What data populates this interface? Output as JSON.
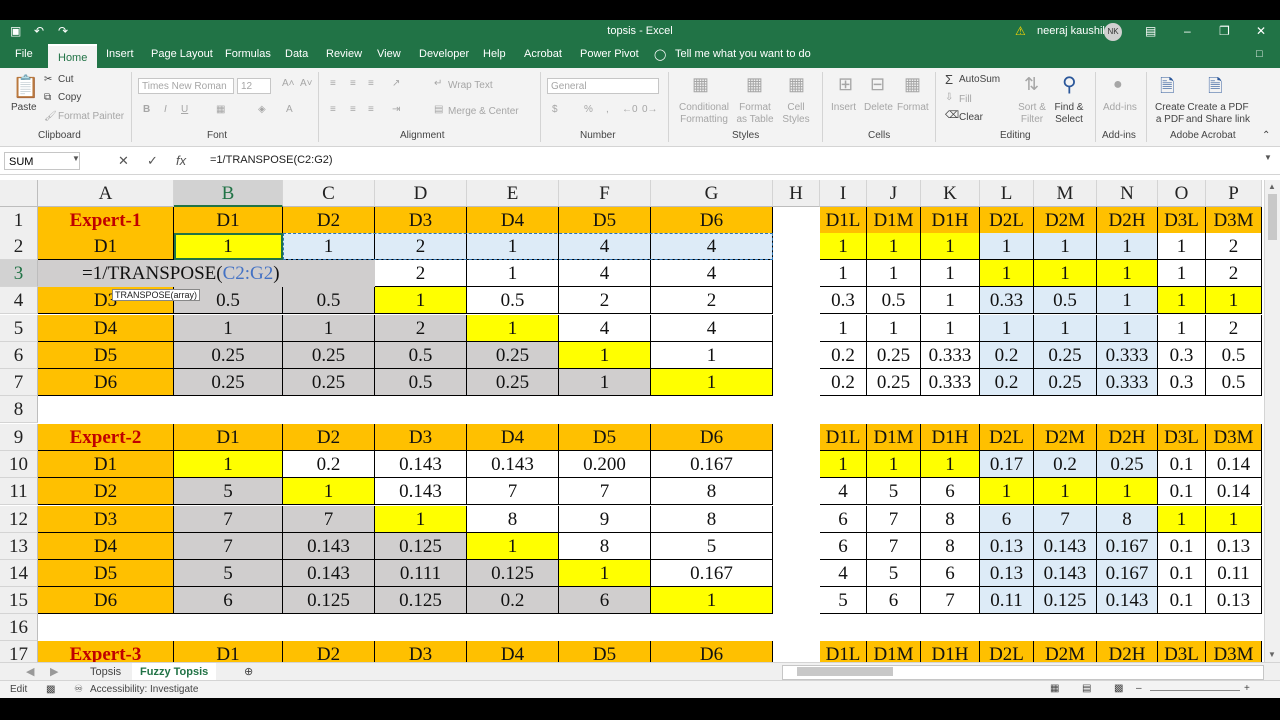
{
  "window": {
    "title": "topsis - Excel",
    "user": "neeraj kaushik",
    "user_initials": "NK",
    "accent": "#217346"
  },
  "menu": [
    "File",
    "Home",
    "Insert",
    "Page Layout",
    "Formulas",
    "Data",
    "Review",
    "View",
    "Developer",
    "Help",
    "Acrobat",
    "Power Pivot"
  ],
  "tell_me": "Tell me what you want to do",
  "ribbon": {
    "paste": "Paste",
    "cut": "Cut",
    "copy": "Copy",
    "format_painter": "Format Painter",
    "clipboard": "Clipboard",
    "font_name": "Times New Roman",
    "font_size": "12",
    "font": "Font",
    "wrap_text": "Wrap Text",
    "merge_center": "Merge & Center",
    "alignment": "Alignment",
    "number_format": "General",
    "number": "Number",
    "conditional_formatting": "Conditional Formatting",
    "format_as_table": "Format as Table",
    "cell_styles": "Cell Styles",
    "styles": "Styles",
    "insert": "Insert",
    "delete": "Delete",
    "format": "Format",
    "cells": "Cells",
    "autosum": "AutoSum",
    "fill": "Fill",
    "clear": "Clear",
    "sort_filter": "Sort & Filter",
    "find_select": "Find & Select",
    "editing": "Editing",
    "addins": "Add-ins",
    "addins_group": "Add-ins",
    "create_pdf": "Create a PDF",
    "create_pdf_share": "Create a PDF and Share link",
    "adobe_acrobat": "Adobe Acrobat"
  },
  "formula_bar": {
    "name_box": "SUM",
    "formula": "=1/TRANSPOSE(C2:G2)"
  },
  "editor": {
    "prefix": "=1/TRANSPOSE(",
    "ref": "C2:G2",
    "suffix": ")",
    "tooltip": "TRANSPOSE(array)"
  },
  "columns": [
    "A",
    "B",
    "C",
    "D",
    "E",
    "F",
    "G",
    "H",
    "I",
    "J",
    "K",
    "L",
    "M",
    "N",
    "O",
    "P"
  ],
  "rows": [
    "1",
    "2",
    "3",
    "4",
    "5",
    "6",
    "7",
    "8",
    "9",
    "10",
    "11",
    "12",
    "13",
    "14",
    "15",
    "16",
    "17"
  ],
  "sheet_tabs": [
    "Topsis",
    "Fuzzy Topsis"
  ],
  "status": {
    "mode": "Edit",
    "accessibility": "Accessibility: Investigate"
  },
  "grid": [
    [
      "Expert-1",
      "D1",
      "D2",
      "D3",
      "D4",
      "D5",
      "D6",
      "",
      "D1L",
      "D1M",
      "D1H",
      "D2L",
      "D2M",
      "D2H",
      "D3L",
      "D3M"
    ],
    [
      "D1",
      "1",
      "1",
      "2",
      "1",
      "4",
      "4",
      "",
      "1",
      "1",
      "1",
      "1",
      "1",
      "1",
      "1",
      "2"
    ],
    [
      "",
      "",
      "",
      "2",
      "1",
      "4",
      "4",
      "",
      "1",
      "1",
      "1",
      "1",
      "1",
      "1",
      "1",
      "2"
    ],
    [
      "D3",
      "0.5",
      "0.5",
      "1",
      "0.5",
      "2",
      "2",
      "",
      "0.3",
      "0.5",
      "1",
      "0.33",
      "0.5",
      "1",
      "1",
      "1"
    ],
    [
      "D4",
      "1",
      "1",
      "2",
      "1",
      "4",
      "4",
      "",
      "1",
      "1",
      "1",
      "1",
      "1",
      "1",
      "1",
      "2"
    ],
    [
      "D5",
      "0.25",
      "0.25",
      "0.5",
      "0.25",
      "1",
      "1",
      "",
      "0.2",
      "0.25",
      "0.333",
      "0.2",
      "0.25",
      "0.333",
      "0.3",
      "0.5"
    ],
    [
      "D6",
      "0.25",
      "0.25",
      "0.5",
      "0.25",
      "1",
      "1",
      "",
      "0.2",
      "0.25",
      "0.333",
      "0.2",
      "0.25",
      "0.333",
      "0.3",
      "0.5"
    ],
    [
      "",
      "",
      "",
      "",
      "",
      "",
      "",
      "",
      "",
      "",
      "",
      "",
      "",
      "",
      "",
      ""
    ],
    [
      "Expert-2",
      "D1",
      "D2",
      "D3",
      "D4",
      "D5",
      "D6",
      "",
      "D1L",
      "D1M",
      "D1H",
      "D2L",
      "D2M",
      "D2H",
      "D3L",
      "D3M"
    ],
    [
      "D1",
      "1",
      "0.2",
      "0.143",
      "0.143",
      "0.200",
      "0.167",
      "",
      "1",
      "1",
      "1",
      "0.17",
      "0.2",
      "0.25",
      "0.1",
      "0.14"
    ],
    [
      "D2",
      "5",
      "1",
      "0.143",
      "7",
      "7",
      "8",
      "",
      "4",
      "5",
      "6",
      "1",
      "1",
      "1",
      "0.1",
      "0.14"
    ],
    [
      "D3",
      "7",
      "7",
      "1",
      "8",
      "9",
      "8",
      "",
      "6",
      "7",
      "8",
      "6",
      "7",
      "8",
      "1",
      "1"
    ],
    [
      "D4",
      "7",
      "0.143",
      "0.125",
      "1",
      "8",
      "5",
      "",
      "6",
      "7",
      "8",
      "0.13",
      "0.143",
      "0.167",
      "0.1",
      "0.13"
    ],
    [
      "D5",
      "5",
      "0.143",
      "0.111",
      "0.125",
      "1",
      "0.167",
      "",
      "4",
      "5",
      "6",
      "0.13",
      "0.143",
      "0.167",
      "0.1",
      "0.11"
    ],
    [
      "D6",
      "6",
      "0.125",
      "0.125",
      "0.2",
      "6",
      "1",
      "",
      "5",
      "6",
      "7",
      "0.11",
      "0.125",
      "0.143",
      "0.1",
      "0.13"
    ],
    [
      "",
      "",
      "",
      "",
      "",
      "",
      "",
      "",
      "",
      "",
      "",
      "",
      "",
      "",
      "",
      ""
    ],
    [
      "Expert-3",
      "D1",
      "D2",
      "D3",
      "D4",
      "D5",
      "D6",
      "",
      "D1L",
      "D1M",
      "D1H",
      "D2L",
      "D2M",
      "D2H",
      "D3L",
      "D3M"
    ]
  ],
  "fills": [
    [
      "o",
      "o",
      "o",
      "o",
      "o",
      "o",
      "o",
      "e",
      "o",
      "o",
      "o",
      "o",
      "o",
      "o",
      "o",
      "o"
    ],
    [
      "o",
      "y",
      "b",
      "b",
      "b",
      "b",
      "b",
      "e",
      "y",
      "y",
      "y",
      "b",
      "b",
      "b",
      "w",
      "w"
    ],
    [
      "o",
      "g",
      "g",
      "w",
      "w",
      "w",
      "w",
      "e",
      "w",
      "w",
      "w",
      "y",
      "y",
      "y",
      "w",
      "w"
    ],
    [
      "o",
      "g",
      "g",
      "y",
      "w",
      "w",
      "w",
      "e",
      "w",
      "w",
      "w",
      "b",
      "b",
      "b",
      "y",
      "y"
    ],
    [
      "o",
      "g",
      "g",
      "g",
      "y",
      "w",
      "w",
      "e",
      "w",
      "w",
      "w",
      "b",
      "b",
      "b",
      "w",
      "w"
    ],
    [
      "o",
      "g",
      "g",
      "g",
      "g",
      "y",
      "w",
      "e",
      "w",
      "w",
      "w",
      "b",
      "b",
      "b",
      "w",
      "w"
    ],
    [
      "o",
      "g",
      "g",
      "g",
      "g",
      "g",
      "y",
      "e",
      "w",
      "w",
      "w",
      "b",
      "b",
      "b",
      "w",
      "w"
    ],
    [
      "e",
      "e",
      "e",
      "e",
      "e",
      "e",
      "e",
      "e",
      "e",
      "e",
      "e",
      "e",
      "e",
      "e",
      "e",
      "e"
    ],
    [
      "o",
      "o",
      "o",
      "o",
      "o",
      "o",
      "o",
      "e",
      "o",
      "o",
      "o",
      "o",
      "o",
      "o",
      "o",
      "o"
    ],
    [
      "o",
      "y",
      "w",
      "w",
      "w",
      "w",
      "w",
      "e",
      "y",
      "y",
      "y",
      "b",
      "b",
      "b",
      "w",
      "w"
    ],
    [
      "o",
      "g",
      "y",
      "w",
      "w",
      "w",
      "w",
      "e",
      "w",
      "w",
      "w",
      "y",
      "y",
      "y",
      "w",
      "w"
    ],
    [
      "o",
      "g",
      "g",
      "y",
      "w",
      "w",
      "w",
      "e",
      "w",
      "w",
      "w",
      "b",
      "b",
      "b",
      "y",
      "y"
    ],
    [
      "o",
      "g",
      "g",
      "g",
      "y",
      "w",
      "w",
      "e",
      "w",
      "w",
      "w",
      "b",
      "b",
      "b",
      "w",
      "w"
    ],
    [
      "o",
      "g",
      "g",
      "g",
      "g",
      "y",
      "w",
      "e",
      "w",
      "w",
      "w",
      "b",
      "b",
      "b",
      "w",
      "w"
    ],
    [
      "o",
      "g",
      "g",
      "g",
      "g",
      "g",
      "y",
      "e",
      "w",
      "w",
      "w",
      "b",
      "b",
      "b",
      "w",
      "w"
    ],
    [
      "e",
      "e",
      "e",
      "e",
      "e",
      "e",
      "e",
      "e",
      "e",
      "e",
      "e",
      "e",
      "e",
      "e",
      "e",
      "e"
    ],
    [
      "o",
      "o",
      "o",
      "o",
      "o",
      "o",
      "o",
      "e",
      "o",
      "o",
      "o",
      "o",
      "o",
      "o",
      "o",
      "o"
    ]
  ]
}
